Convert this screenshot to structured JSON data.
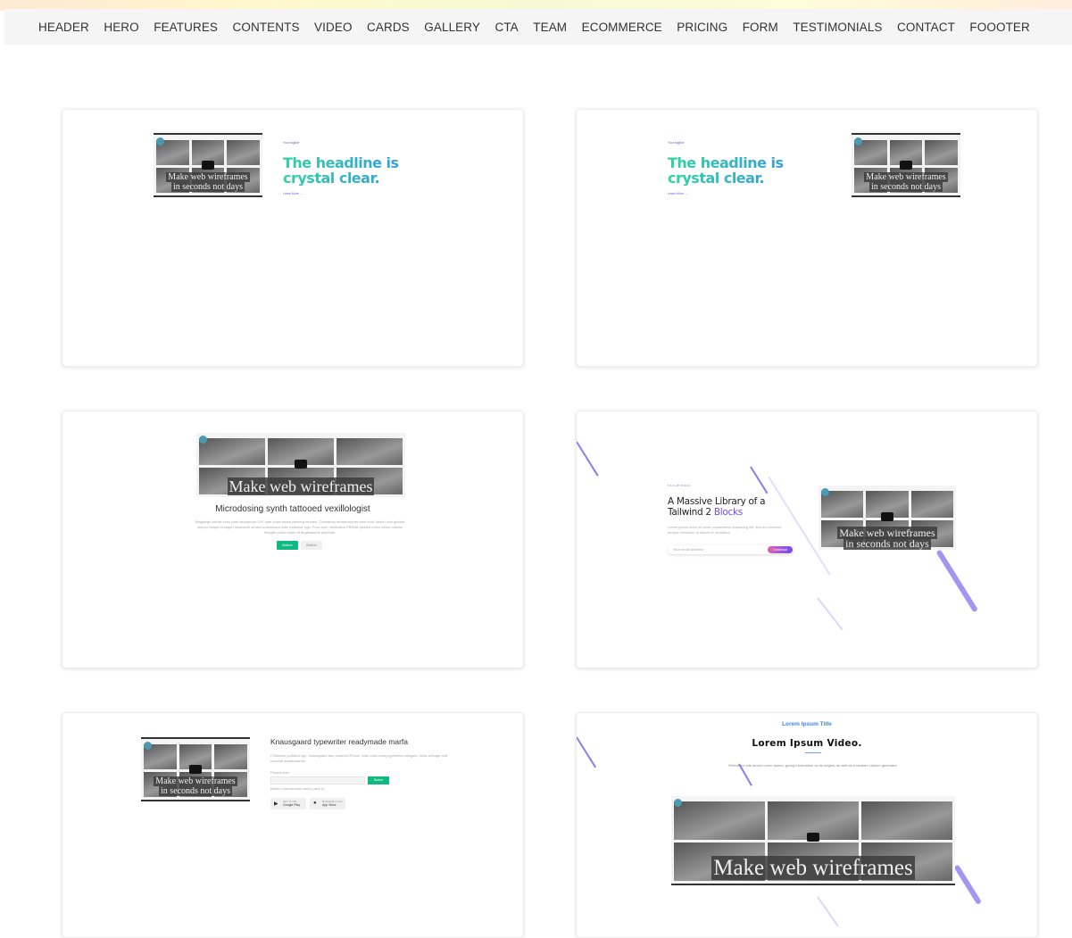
{
  "nav": [
    "HEADER",
    "HERO",
    "FEATURES",
    "CONTENTS",
    "VIDEO",
    "CARDS",
    "GALLERY",
    "CTA",
    "TEAM",
    "ECOMMERCE",
    "PRICING",
    "FORM",
    "TESTIMONIALS",
    "CONTACT",
    "FOOOTER"
  ],
  "thumb": {
    "line1": "Make web wireframes",
    "line2": "in seconds not days"
  },
  "card1": {
    "tagline": "Your tagline",
    "headline": "The headline is crystal clear.",
    "link": "Learn More →"
  },
  "card2": {
    "tagline": "Your tagline",
    "headline": "The headline is crystal clear.",
    "link": "Learn More →"
  },
  "card3": {
    "title": "Microdosing synth tattooed vexillologist",
    "body": "Meggings kinfolk echo park stumptown DIY, kale chips beard jianbing tousled. Chambray dreamcatcher trust fund, kitsch vice godard disrupt ramps hexagon mustache umami snackwave tilde chillwave ugh. Pour-over meditation PBR&B pickled ennui celiac mlkshk freegan photo booth af fingerstache pitchfork.",
    "primary": "Button",
    "secondary": "Button"
  },
  "card4": {
    "eyebrow": "TAILWINDUI",
    "title1": "A Massive Library of a",
    "title2": "Tailwind 2",
    "title_accent": "Blocks",
    "body": "Lorem ipsum dolor sit amet, consectetur adipiscing elit, sed do eiusmod tempor incididunt ut labore et incididunt.",
    "placeholder": "Your email address",
    "button": "Download"
  },
  "card5": {
    "title": "Knausgaard typewriter readymade marfa",
    "body": "Chillwave portland ugh, knausgaard fam polaroid iPhone. Man braid swag typewriter affogato, hella selvage wolf narwhal dreamcatcher.",
    "label": "Placeholder",
    "button": "Button",
    "note": "Bitters chicharrones fanny pack yr.",
    "gp_small": "GET IT ON",
    "gp": "Google Play",
    "as_small": "Download on the",
    "as": "App Store"
  },
  "card6": {
    "eyebrow": "Lorem Ipsum Title",
    "title": "Lorem Ipsum Video.",
    "body": "Reference site about Lorem Ipsum, giving information on its origins, as well as a random Lipsum generator."
  },
  "colors": {
    "green": "#10b981",
    "purple": "#6d4ef0",
    "blue": "#3b82f6"
  }
}
